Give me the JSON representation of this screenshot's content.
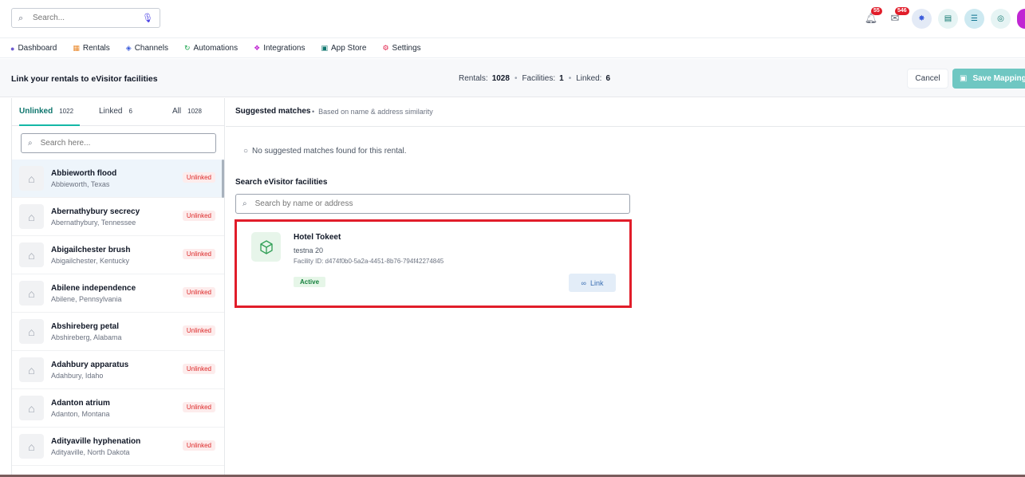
{
  "topbar": {
    "search_placeholder": "Search...",
    "notifications_count": "55",
    "messages_count": "546"
  },
  "nav": {
    "items": [
      {
        "label": "Dashboard",
        "icon": "gauge-icon",
        "color": "#6d5bd0"
      },
      {
        "label": "Rentals",
        "icon": "building-icon",
        "color": "#ea8a2e"
      },
      {
        "label": "Channels",
        "icon": "layers-icon",
        "color": "#3b5bdb"
      },
      {
        "label": "Automations",
        "icon": "refresh-icon",
        "color": "#16a34a"
      },
      {
        "label": "Integrations",
        "icon": "puzzle-icon",
        "color": "#c026d3"
      },
      {
        "label": "App Store",
        "icon": "store-icon",
        "color": "#0f766e"
      },
      {
        "label": "Settings",
        "icon": "gear-icon",
        "color": "#e11d48"
      }
    ]
  },
  "header": {
    "title": "Link your rentals to eVisitor facilities",
    "rentals_label": "Rentals:",
    "rentals_value": "1028",
    "facilities_label": "Facilities:",
    "facilities_value": "1",
    "linked_label": "Linked:",
    "linked_value": "6",
    "cancel_label": "Cancel",
    "save_label": "Save Mapping"
  },
  "left": {
    "tabs": [
      {
        "label": "Unlinked",
        "count": "1022"
      },
      {
        "label": "Linked",
        "count": "6"
      },
      {
        "label": "All",
        "count": "1028"
      }
    ],
    "search_placeholder": "Search here...",
    "status_label": "Unlinked",
    "rentals": [
      {
        "name": "Abbieworth flood",
        "location": "Abbieworth, Texas"
      },
      {
        "name": "Abernathybury secrecy",
        "location": "Abernathybury, Tennessee"
      },
      {
        "name": "Abigailchester brush",
        "location": "Abigailchester, Kentucky"
      },
      {
        "name": "Abilene independence",
        "location": "Abilene, Pennsylvania"
      },
      {
        "name": "Abshireberg petal",
        "location": "Abshireberg, Alabama"
      },
      {
        "name": "Adahbury apparatus",
        "location": "Adahbury, Idaho"
      },
      {
        "name": "Adanton atrium",
        "location": "Adanton, Montana"
      },
      {
        "name": "Adityaville hyphenation",
        "location": "Adityaville, North Dakota"
      }
    ]
  },
  "right": {
    "suggested_title": "Suggested matches",
    "suggested_sub": "Based on name & address similarity",
    "no_match": "No suggested matches found for this rental.",
    "search_title": "Search eVisitor facilities",
    "search_placeholder": "Search by name or address",
    "facility": {
      "name": "Hotel Tokeet",
      "address": "testna 20",
      "facility_id": "Facility ID: d474f0b0-5a2a-4451-8b76-794f42274845",
      "status": "Active",
      "link_label": "Link"
    }
  }
}
